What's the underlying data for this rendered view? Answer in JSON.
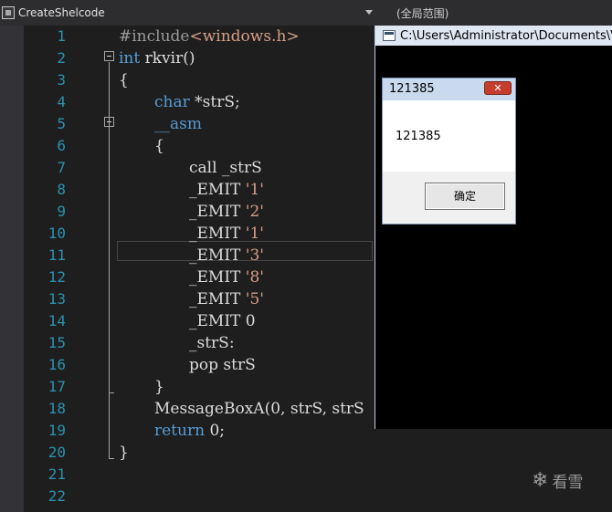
{
  "scope_bar": {
    "left_label": "CreateShelcode",
    "right_label": "(全局范围)"
  },
  "code_lines": [
    {
      "n": "1",
      "text": "#include<windows.h>"
    },
    {
      "n": "2",
      "text": "int rkvir()"
    },
    {
      "n": "3",
      "text": "{"
    },
    {
      "n": "4",
      "text": "char *strS;"
    },
    {
      "n": "5",
      "text": "__asm"
    },
    {
      "n": "6",
      "text": "{"
    },
    {
      "n": "7",
      "text": "call _strS"
    },
    {
      "n": "8",
      "text": "_EMIT '1'"
    },
    {
      "n": "9",
      "text": "_EMIT '2'"
    },
    {
      "n": "10",
      "text": "_EMIT '1'"
    },
    {
      "n": "11",
      "text": "_EMIT '3'"
    },
    {
      "n": "12",
      "text": "_EMIT '8'"
    },
    {
      "n": "13",
      "text": "_EMIT '5'"
    },
    {
      "n": "14",
      "text": "_EMIT 0"
    },
    {
      "n": "15",
      "text": "_strS:"
    },
    {
      "n": "16",
      "text": "pop strS"
    },
    {
      "n": "17",
      "text": "}"
    },
    {
      "n": "18",
      "text": "MessageBoxA(0, strS, strS"
    },
    {
      "n": "19",
      "text": "return 0;"
    },
    {
      "n": "20",
      "text": "}"
    },
    {
      "n": "21",
      "text": ""
    },
    {
      "n": "22",
      "text": ""
    }
  ],
  "console": {
    "title": "C:\\Users\\Administrator\\Documents\\Vis"
  },
  "message_box": {
    "title": "121385",
    "close_label": "✕",
    "message": "121385",
    "ok_label": "确定"
  },
  "watermark": {
    "text": "看雪"
  },
  "colors": {
    "editor_bg": "#1e1e1e",
    "line_number": "#2b91af",
    "keyword": "#569cd6",
    "string_literal": "#d69d85",
    "preprocessor": "#9b9b9b",
    "plain_text": "#dcdcdc"
  }
}
